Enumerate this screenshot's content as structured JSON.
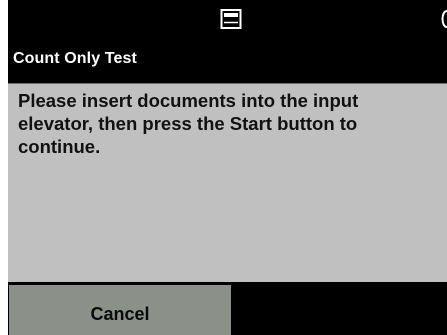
{
  "status_bar": {
    "device_icon": "scanner-tray-icon",
    "edge_icon": "partial-status-icon"
  },
  "title_bar": {
    "title": "Count Only Test"
  },
  "message": {
    "text": "Please insert documents into the input elevator, then press the Start button to continue."
  },
  "actions": {
    "cancel_label": "Cancel"
  },
  "colors": {
    "screen_background": "#000000",
    "panel_background": "#c0c0c0",
    "cancel_button": "#8b9089",
    "title_text": "#ffffff",
    "message_text": "#111111"
  }
}
